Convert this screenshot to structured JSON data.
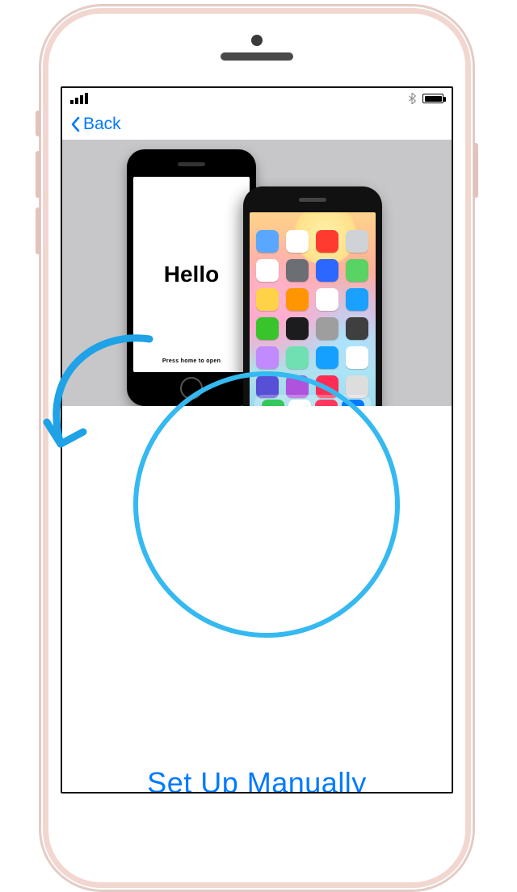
{
  "statusbar": {
    "bluetooth_name": "bluetooth-icon",
    "battery_name": "battery-icon"
  },
  "nav": {
    "back_label": "Back"
  },
  "hero": {
    "hello_text": "Hello",
    "hello_subtext": "Press home to open"
  },
  "actions": {
    "setup_manually_label": "Set Up Manually"
  },
  "annotation": {
    "accent_color": "#35b9f0"
  },
  "app_colors": [
    "#5aa7ff",
    "#ffffff",
    "#ff3b30",
    "#cfd3d8",
    "#ffffff",
    "#6b6e73",
    "#2c68ff",
    "#58d364",
    "#ffd247",
    "#ff9500",
    "#ffffff",
    "#1aa0ff",
    "#38c42a",
    "#1c1c1e",
    "#9e9e9e",
    "#3f3f3f",
    "#c18aff",
    "#70e0b3",
    "#15a0ff",
    "#ffffff",
    "#574fd6",
    "#af52de",
    "#ff2d55",
    "#dddddd"
  ],
  "dock_colors": [
    "#34c759",
    "#ffffff",
    "#ff375f",
    "#007aff"
  ]
}
